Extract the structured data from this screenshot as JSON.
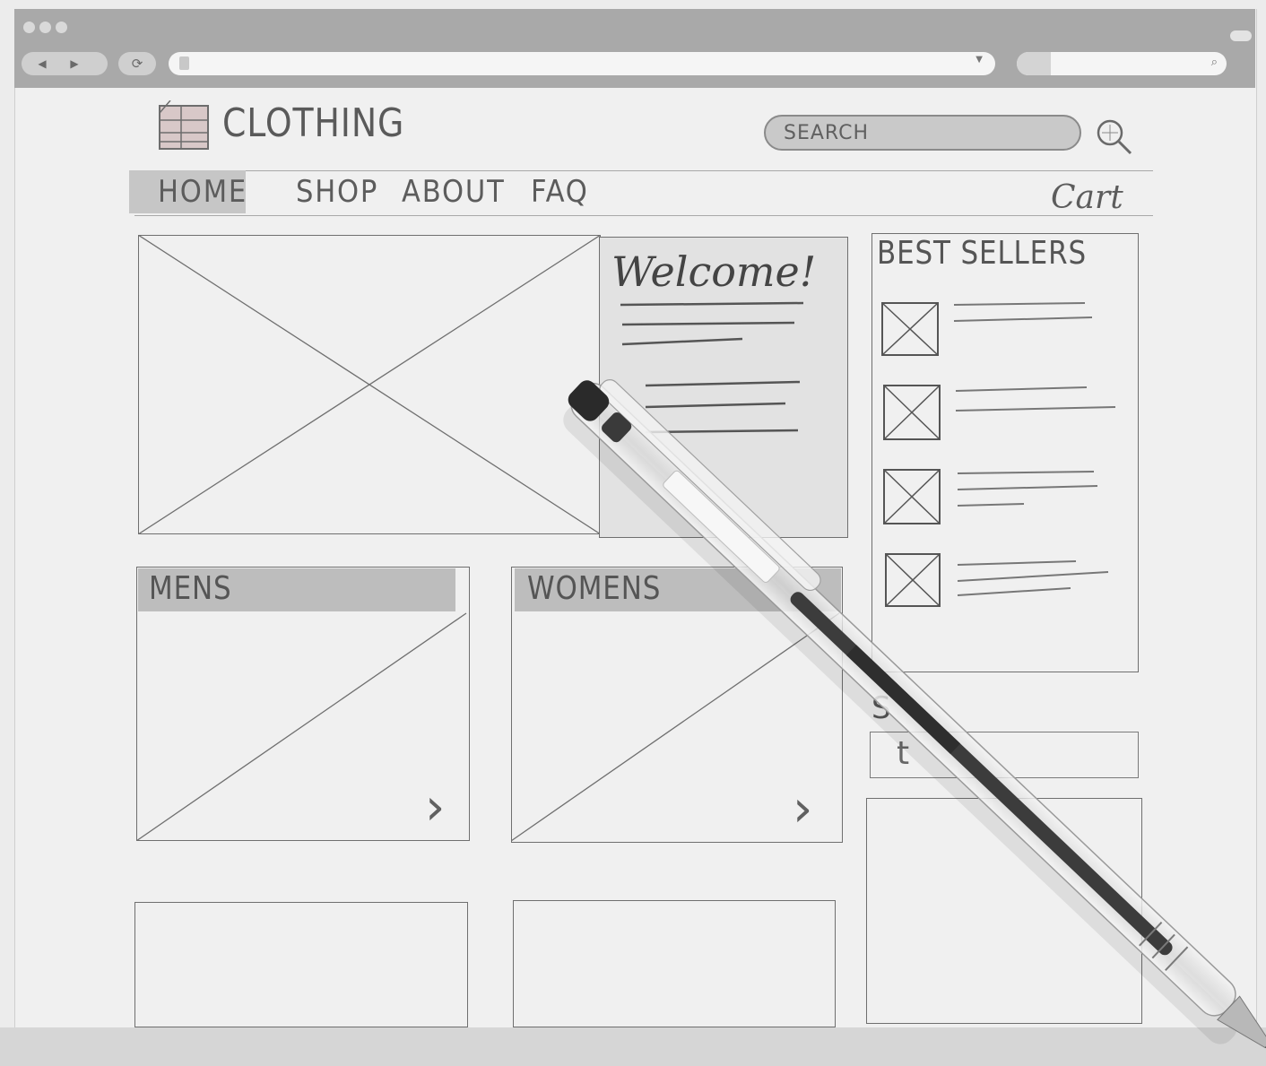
{
  "browser": {
    "back_icon": "back-arrow-icon",
    "forward_icon": "forward-arrow-icon",
    "reload_icon": "reload-icon",
    "search_icon": "magnifier-icon"
  },
  "site": {
    "logo_text": "CLOTHING",
    "search_placeholder": "SEARCH",
    "nav": {
      "home": "HOME",
      "shop": "SHOP",
      "about": "ABOUT",
      "faq": "FAQ",
      "cart": "Cart"
    },
    "welcome_title": "Welcome!",
    "best_sellers_title": "BEST SELLERS",
    "categories": {
      "mens": "MENS",
      "womens": "WOMENS"
    },
    "social_title": "S"
  },
  "colors": {
    "paper": "#ececec",
    "chrome": "#a9a9a9",
    "ink": "#4d4d4d",
    "highlight": "#c6c6c6"
  }
}
